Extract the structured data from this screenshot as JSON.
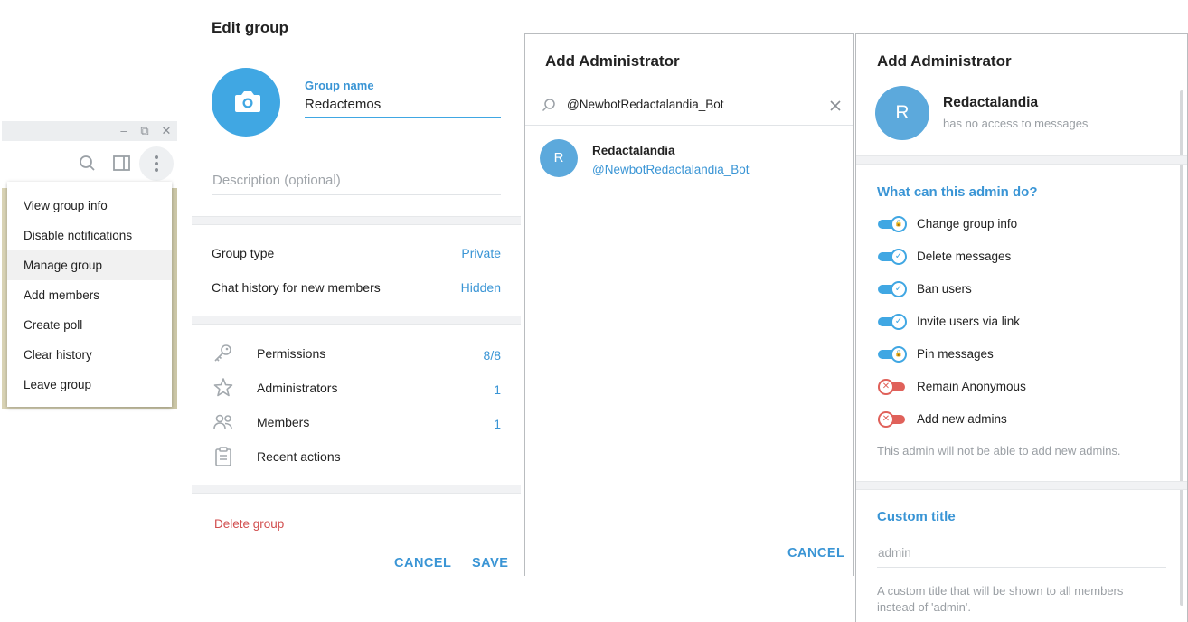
{
  "chat_window": {
    "window_controls": {
      "minimize": "–",
      "restore": "⧉",
      "close": "✕"
    },
    "menu": {
      "items": [
        {
          "label": "View group info",
          "active": false
        },
        {
          "label": "Disable notifications",
          "active": false
        },
        {
          "label": "Manage group",
          "active": true
        },
        {
          "label": "Add members",
          "active": false
        },
        {
          "label": "Create poll",
          "active": false
        },
        {
          "label": "Clear history",
          "active": false
        },
        {
          "label": "Leave group",
          "active": false
        }
      ]
    }
  },
  "edit_group": {
    "title": "Edit group",
    "group_name_label": "Group name",
    "group_name_value": "Redactemos",
    "description_placeholder": "Description (optional)",
    "group_type_label": "Group type",
    "group_type_value": "Private",
    "history_label": "Chat history for new members",
    "history_value": "Hidden",
    "rows": [
      {
        "label": "Permissions",
        "value": "8/8",
        "icon": "key-icon"
      },
      {
        "label": "Administrators",
        "value": "1",
        "icon": "star-icon"
      },
      {
        "label": "Members",
        "value": "1",
        "icon": "members-icon"
      },
      {
        "label": "Recent actions",
        "value": "",
        "icon": "clipboard-icon"
      }
    ],
    "delete_label": "Delete group",
    "cancel_label": "CANCEL",
    "save_label": "SAVE"
  },
  "add_admin_search": {
    "title": "Add Administrator",
    "search_value": "@NewbotRedactalandia_Bot",
    "result": {
      "initial": "R",
      "name": "Redactalandia",
      "username": "@NewbotRedactalandia_Bot"
    },
    "cancel_label": "CANCEL"
  },
  "admin_rights": {
    "title": "Add Administrator",
    "user": {
      "initial": "R",
      "name": "Redactalandia",
      "status": "has no access to messages"
    },
    "section_title": "What can this admin do?",
    "permissions": [
      {
        "label": "Change group info",
        "enabled": true,
        "glyph": "🔒"
      },
      {
        "label": "Delete messages",
        "enabled": true,
        "glyph": "✓"
      },
      {
        "label": "Ban users",
        "enabled": true,
        "glyph": "✓"
      },
      {
        "label": "Invite users via link",
        "enabled": true,
        "glyph": "✓"
      },
      {
        "label": "Pin messages",
        "enabled": true,
        "glyph": "🔒"
      },
      {
        "label": "Remain Anonymous",
        "enabled": false,
        "glyph": "✕"
      },
      {
        "label": "Add new admins",
        "enabled": false,
        "glyph": "✕"
      }
    ],
    "admins_note": "This admin will not be able to add new admins.",
    "custom_title_label": "Custom title",
    "custom_title_placeholder": "admin",
    "custom_title_note": "A custom title that will be shown to all members instead of 'admin'."
  },
  "colors": {
    "accent": "#40a7e3",
    "link": "#3a95d5",
    "danger": "#d14e4e",
    "toggle_off": "#e0615a"
  }
}
